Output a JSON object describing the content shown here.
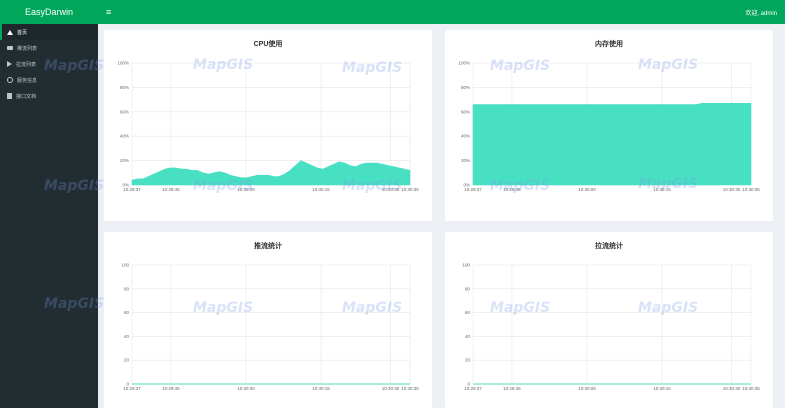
{
  "app": {
    "brand": "EasyDarwin",
    "toggle": "≡",
    "user": "欢迎, admin"
  },
  "sidebar": {
    "items": [
      {
        "label": "首页",
        "icon": "home-icon"
      },
      {
        "label": "推流列表",
        "icon": "video-icon"
      },
      {
        "label": "拉流列表",
        "icon": "play-icon"
      },
      {
        "label": "服务信息",
        "icon": "gear-icon"
      },
      {
        "label": "接口文档",
        "icon": "doc-icon"
      }
    ]
  },
  "watermark": "MapGIS",
  "colors": {
    "accent": "#00a65a",
    "series": "#48e0c2",
    "sidebar": "#222d32"
  },
  "chart_data": [
    {
      "type": "area",
      "title": "CPU使用",
      "y_ticks": [
        "100%",
        "80%",
        "60%",
        "40%",
        "20%",
        "0%"
      ],
      "ylim": [
        0,
        100
      ],
      "x_ticks": [
        "10:29:37",
        "10:29:45",
        "10:30:00",
        "10:30:15",
        "10:30:30",
        "10:30:35"
      ],
      "values": [
        4,
        5,
        5,
        7,
        9,
        11,
        13,
        14,
        14,
        13,
        13,
        12,
        12,
        10,
        9,
        10,
        11,
        10,
        8,
        7,
        6,
        6,
        7,
        8,
        8,
        8,
        7,
        7,
        9,
        12,
        16,
        20,
        18,
        16,
        14,
        13,
        15,
        17,
        19,
        18,
        16,
        15,
        17,
        18,
        18,
        18,
        17,
        16,
        15,
        14,
        13,
        12
      ]
    },
    {
      "type": "area",
      "title": "内存使用",
      "y_ticks": [
        "100%",
        "80%",
        "60%",
        "40%",
        "20%",
        "0%"
      ],
      "ylim": [
        0,
        100
      ],
      "x_ticks": [
        "10:29:37",
        "10:29:45",
        "10:30:00",
        "10:30:15",
        "10:30:30",
        "10:30:35"
      ],
      "values": [
        66,
        66,
        66,
        66,
        66,
        66,
        66,
        66,
        66,
        66,
        66,
        66,
        66,
        66,
        66,
        66,
        66,
        66,
        66,
        66,
        66,
        66,
        66,
        66,
        66,
        66,
        66,
        66,
        66,
        66,
        66,
        66,
        66,
        66,
        66,
        66,
        66,
        66,
        66,
        66,
        66,
        66,
        67,
        67,
        67,
        67,
        67,
        67,
        67,
        67,
        67,
        67
      ]
    },
    {
      "type": "line",
      "title": "推流统计",
      "y_ticks": [
        "100",
        "80",
        "60",
        "40",
        "20",
        "0"
      ],
      "ylim": [
        0,
        100
      ],
      "x_ticks": [
        "10:29:37",
        "10:29:45",
        "10:30:00",
        "10:30:15",
        "10:30:30",
        "10:30:35"
      ],
      "values": [
        0,
        0,
        0,
        0,
        0,
        0,
        0,
        0,
        0,
        0,
        0,
        0,
        0,
        0,
        0,
        0,
        0,
        0,
        0,
        0,
        0,
        0,
        0,
        0,
        0,
        0,
        0,
        0,
        0,
        0,
        0,
        0,
        0,
        0,
        0,
        0,
        0,
        0,
        0,
        0,
        0,
        0,
        0,
        0,
        0,
        0,
        0,
        0,
        0,
        0,
        0,
        0
      ]
    },
    {
      "type": "line",
      "title": "拉流统计",
      "y_ticks": [
        "100",
        "80",
        "60",
        "40",
        "20",
        "0"
      ],
      "ylim": [
        0,
        100
      ],
      "x_ticks": [
        "10:29:37",
        "10:29:45",
        "10:30:00",
        "10:30:15",
        "10:30:30",
        "10:30:35"
      ],
      "values": [
        0,
        0,
        0,
        0,
        0,
        0,
        0,
        0,
        0,
        0,
        0,
        0,
        0,
        0,
        0,
        0,
        0,
        0,
        0,
        0,
        0,
        0,
        0,
        0,
        0,
        0,
        0,
        0,
        0,
        0,
        0,
        0,
        0,
        0,
        0,
        0,
        0,
        0,
        0,
        0,
        0,
        0,
        0,
        0,
        0,
        0,
        0,
        0,
        0,
        0,
        0,
        0
      ]
    }
  ]
}
